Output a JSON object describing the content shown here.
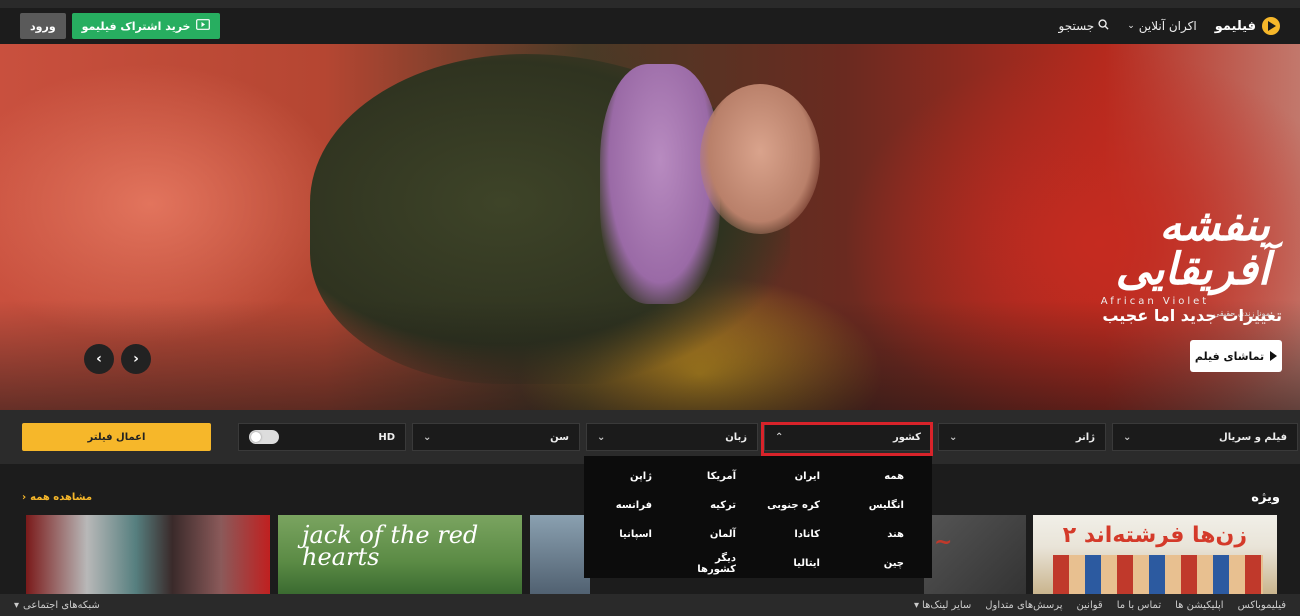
{
  "header": {
    "logo_text": "فیلیمو",
    "nav_online": "اکران آنلاین",
    "nav_search": "جستجو",
    "subscribe_label": "خرید اشتراک فیلیمو",
    "login_label": "ورود"
  },
  "hero": {
    "logo_fa": "بنفشه آفریقایی",
    "logo_en": "African Violet",
    "logo_director": "مونا زندی حقیقی",
    "tagline": "تغییرات جدید اما عجیب",
    "watch_label": "تماشای فیلم"
  },
  "filters": {
    "type_label": "فیلم و سریال",
    "genre_label": "ژانر",
    "country_label": "کشور",
    "language_label": "زبان",
    "age_label": "سن",
    "hd_label": "HD",
    "apply_label": "اعمال فیلتر"
  },
  "country_dropdown": {
    "options": [
      "همه",
      "ایران",
      "آمریکا",
      "ژاپن",
      "انگلیس",
      "کره جنوبی",
      "ترکیه",
      "فرانسه",
      "هند",
      "کانادا",
      "آلمان",
      "اسپانیا",
      "چین",
      "ایتالیا",
      "دیگر کشورها"
    ]
  },
  "section": {
    "title": "ویژه",
    "see_all": "مشاهده همه",
    "poster2_text": "jack of the red hearts",
    "poster5_text": "زن‌ها فرشته‌اند ۲"
  },
  "footer": {
    "links": [
      "فیلیموباکس",
      "اپلیکیشن ها",
      "تماس با ما",
      "قوانین",
      "پرسش‌های متداول",
      "سایر لینک‌ها"
    ],
    "social_label": "شبکه‌های اجتماعی"
  },
  "colors": {
    "accent": "#f6b72a",
    "subscribe": "#27ae60",
    "highlight": "#d8232a"
  }
}
